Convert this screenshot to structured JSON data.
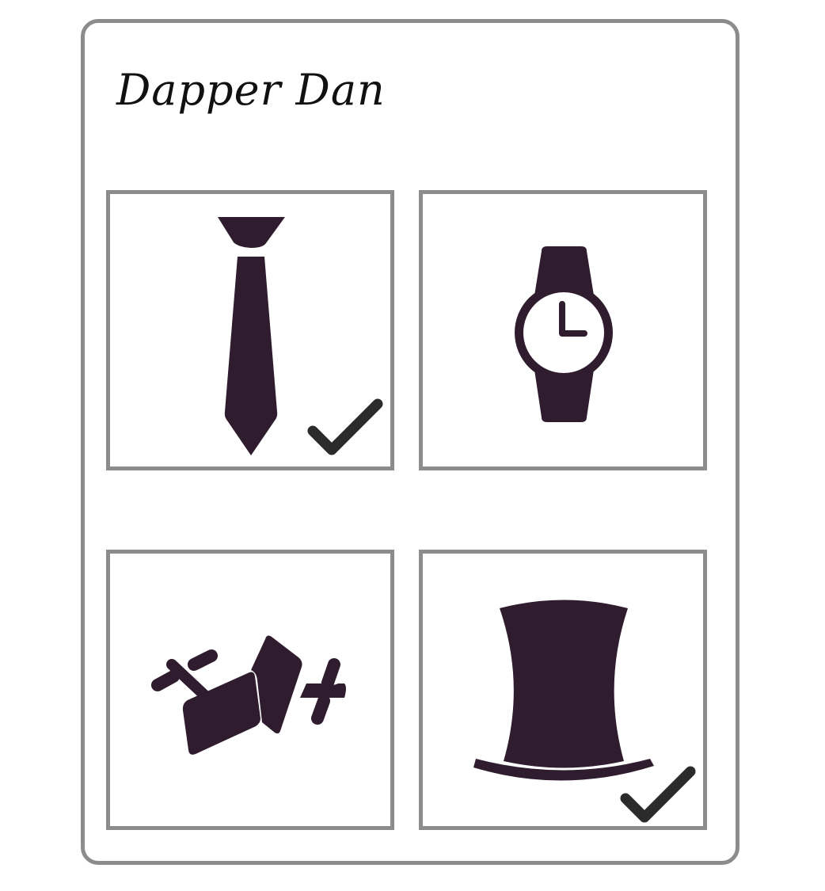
{
  "header": {
    "title": "Dapper Dan"
  },
  "colors": {
    "icon": "#2f1c2e",
    "border": "#8c8c8c",
    "check": "#2b2b2b",
    "background": "#ffffff"
  },
  "tiles": [
    {
      "icon": "necktie-icon",
      "selected": true
    },
    {
      "icon": "wristwatch-icon",
      "selected": false
    },
    {
      "icon": "cufflinks-pocket-square-icon",
      "selected": false
    },
    {
      "icon": "top-hat-icon",
      "selected": true
    }
  ]
}
